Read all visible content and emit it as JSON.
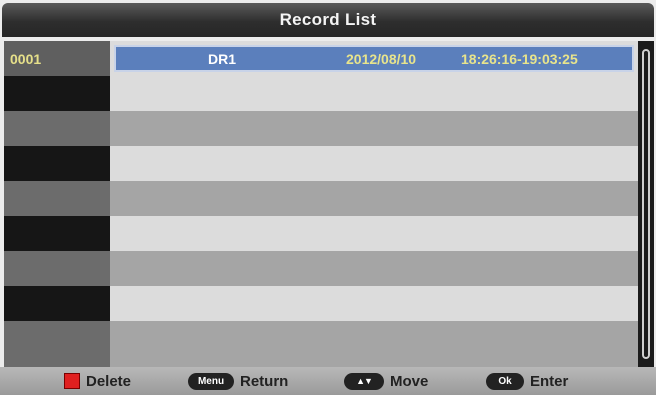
{
  "title": "Record List",
  "records": [
    {
      "number": "0001",
      "name": "DR1",
      "date": "2012/08/10",
      "time": "18:26:16-19:03:25"
    }
  ],
  "footer": {
    "delete_label": "Delete",
    "menu_key": "Menu",
    "return_label": "Return",
    "move_key": "▲▼",
    "move_label": "Move",
    "ok_key": "Ok",
    "enter_label": "Enter"
  },
  "colors": {
    "selection": "#5b7fbc",
    "highlight_text": "#e8e48c",
    "delete_key": "#e02020"
  }
}
